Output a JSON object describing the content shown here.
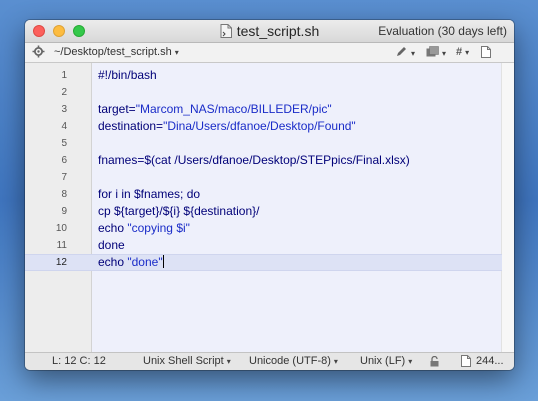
{
  "window": {
    "title": "test_script.sh",
    "evaluation_notice": "Evaluation (30 days left)"
  },
  "navbar": {
    "path": "~/Desktop/test_script.sh",
    "caret": "▾",
    "pen_icon": "pencil-icon",
    "doc_icon": "document-icon",
    "hash_label": "#"
  },
  "editor": {
    "lines": [
      {
        "number": "1",
        "text": "#!/bin/bash"
      },
      {
        "number": "2",
        "text": ""
      },
      {
        "number": "3",
        "text": "target=\"Marcom_NAS/maco/BILLEDER/pic\""
      },
      {
        "number": "4",
        "text": "destination=\"Dina/Users/dfanoe/Desktop/Found\""
      },
      {
        "number": "5",
        "text": ""
      },
      {
        "number": "6",
        "text": "fnames=$(cat /Users/dfanoe/Desktop/STEPpics/Final.xlsx)"
      },
      {
        "number": "7",
        "text": ""
      },
      {
        "number": "8",
        "text": "for i in $fnames; do"
      },
      {
        "number": "9",
        "text": "cp ${target}/${i} ${destination}/"
      },
      {
        "number": "10",
        "text": "echo \"copying $i\""
      },
      {
        "number": "11",
        "text": "done"
      },
      {
        "number": "12",
        "text": "echo \"done\""
      }
    ],
    "current_line": 12
  },
  "statusbar": {
    "position": "L: 12 C: 12",
    "syntax": "Unix Shell Script",
    "encoding": "Unicode (UTF-8)",
    "line_endings": "Unix (LF)",
    "size": "244..."
  },
  "colors": {
    "close": "#fc605c",
    "minimize": "#fdbc40",
    "maximize": "#34c84a",
    "code_text": "#000078",
    "string_text": "#1a2cc8",
    "current_line": "#dde2f5"
  }
}
